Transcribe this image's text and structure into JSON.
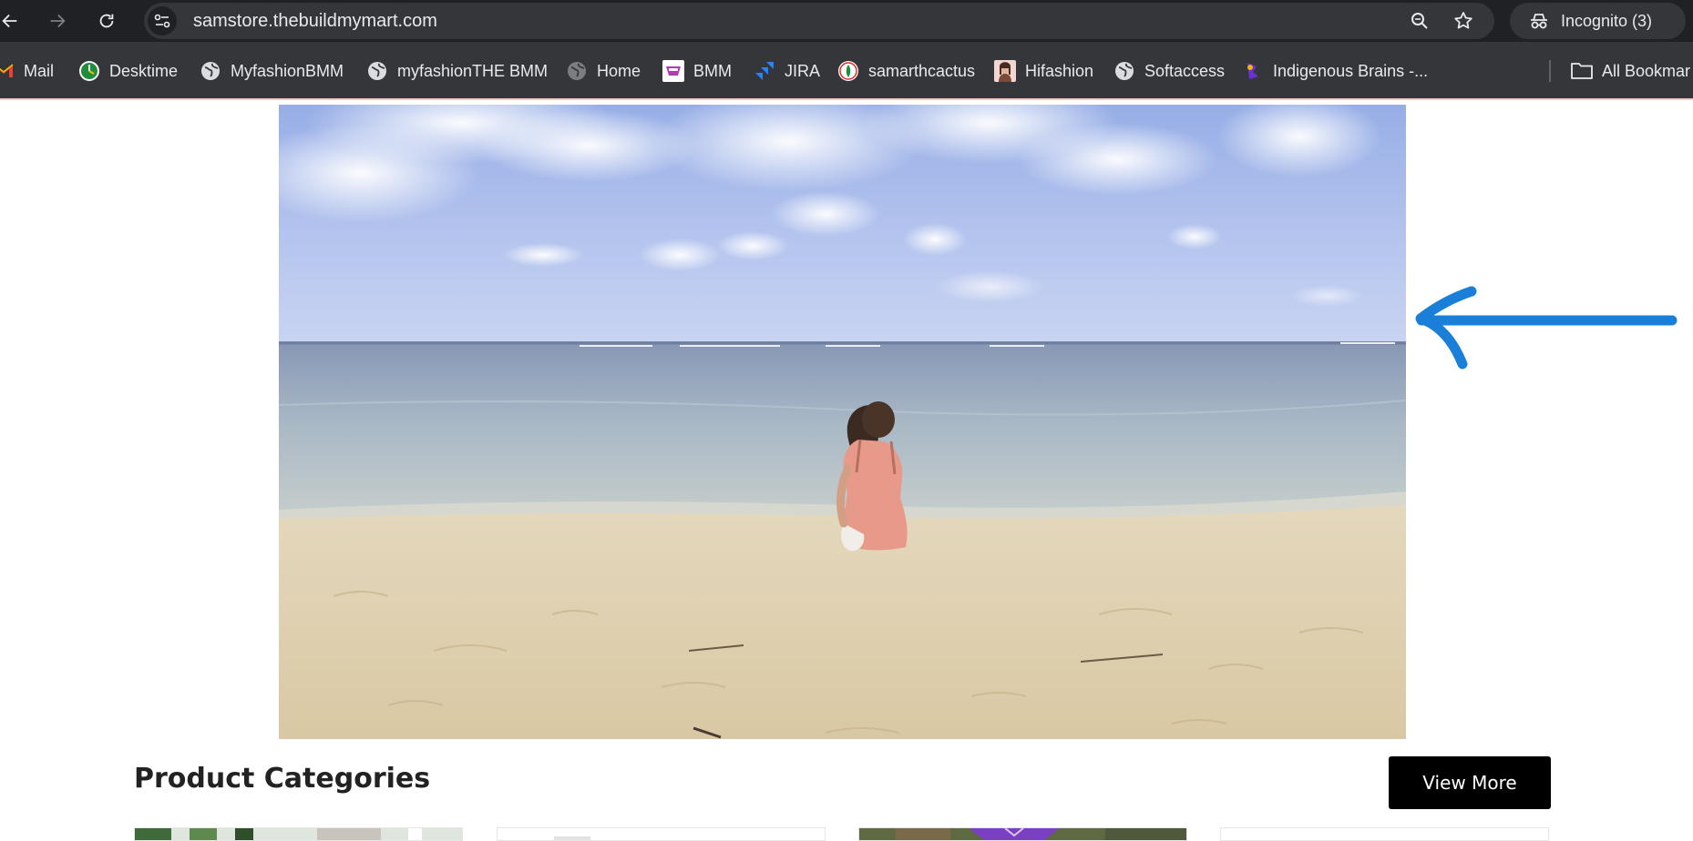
{
  "browser": {
    "url": "samstore.thebuildmymart.com",
    "incognito_label": "Incognito (3)"
  },
  "bookmarks": [
    {
      "label": "Mail",
      "icon": "gmail-icon"
    },
    {
      "label": "Desktime",
      "icon": "desktime-icon"
    },
    {
      "label": "MyfashionBMM",
      "icon": "globe-icon"
    },
    {
      "label": "myfashionTHE BMM",
      "icon": "globe-icon"
    },
    {
      "label": "Home",
      "icon": "globe-icon"
    },
    {
      "label": "BMM",
      "icon": "bmm-icon"
    },
    {
      "label": "JIRA",
      "icon": "jira-icon"
    },
    {
      "label": "samarthcactus",
      "icon": "cactus-icon"
    },
    {
      "label": "Hifashion",
      "icon": "hifashion-icon"
    },
    {
      "label": "Softaccess",
      "icon": "globe-icon"
    },
    {
      "label": "Indigenous Brains -...",
      "icon": "indigenous-icon"
    }
  ],
  "all_bookmarks_label": "All Bookmar",
  "section": {
    "title": "Product Categories",
    "view_more_label": "View More"
  },
  "colors": {
    "chrome_dark": "#202124",
    "chrome_bar": "#35363a",
    "annotation_arrow": "#1a7fd8",
    "button_bg": "#000000"
  }
}
